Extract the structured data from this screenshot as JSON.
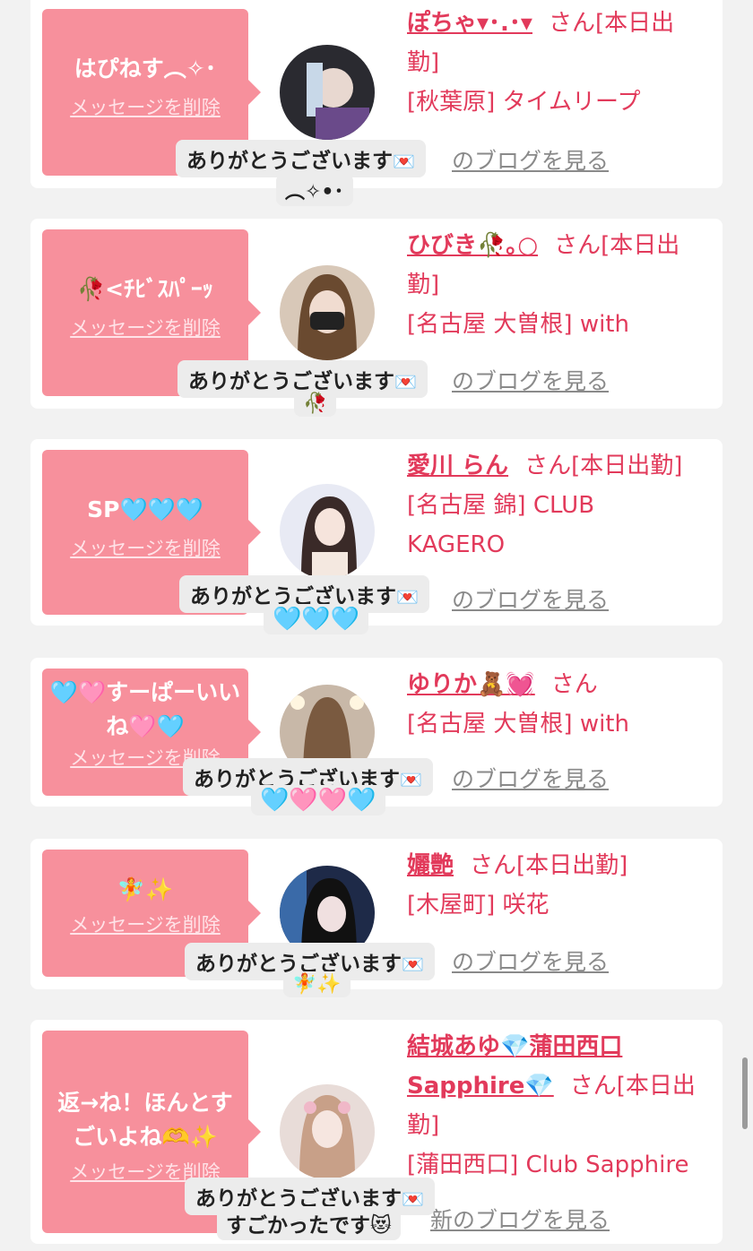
{
  "common": {
    "san": "さん",
    "delete_label": "メッセージを削除",
    "blog_label": "のブログを見る",
    "blog_label_full": "新のブログを見る",
    "thanks": "ありがとうございます",
    "mail_icon": "💌"
  },
  "cards": [
    {
      "message": "はぴねす︵✧･",
      "name": "ぽちゃ▾･.･▾",
      "info1": "[本日出",
      "info2": "勤]",
      "info3": "[秋葉原] タイムリープ",
      "reply_extra": "︵✧•･"
    },
    {
      "message": "🥀<ﾁﾋﾞｽﾊﾟｰｯ",
      "name": "ひびき🥀｡○",
      "info1": "[本日出",
      "info2": "勤]",
      "info3": "[名古屋 大曽根] with",
      "reply_extra": "🥀"
    },
    {
      "message": "SP🩵🩵🩵",
      "name": "愛川 らん",
      "info1": "[本日出勤]",
      "info2": "[名古屋 錦] CLUB",
      "info3": "KAGERO",
      "reply_extra": "🩵🩵🩵"
    },
    {
      "message": "🩵🩷すーぱーいいね🩷🩵",
      "name": "ゆりか🧸💓",
      "info1": "",
      "info2": "[名古屋 大曽根] with",
      "info3": "",
      "reply_extra": "🩵🩷🩷🩵"
    },
    {
      "message": "🧚✨",
      "name": "孋艶",
      "info1": "[本日出勤]",
      "info2": "[木屋町] 咲花",
      "info3": "",
      "reply_extra": "🧚✨"
    },
    {
      "message": "返→ね！ほんとすごいよね🫶✨",
      "name": "結城あゆ💎蒲田西口",
      "name2": "Sapphire💎",
      "info1": "[本日出",
      "info2": "勤]",
      "info3": "[蒲田西口] Club Sapphire",
      "reply_extra": "すごかったです😻"
    }
  ]
}
